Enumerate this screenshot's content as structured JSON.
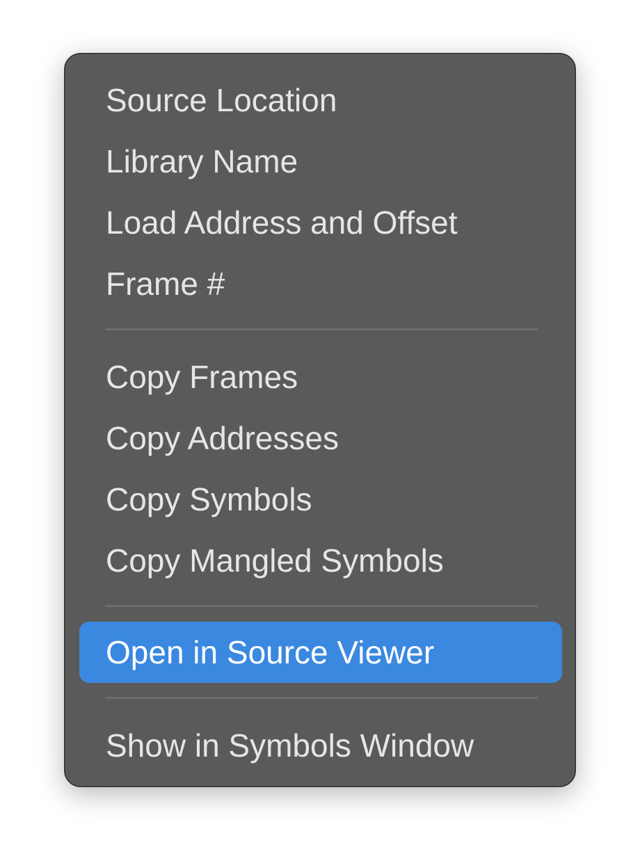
{
  "menu": {
    "items": [
      {
        "label": "Source Location"
      },
      {
        "label": "Library Name"
      },
      {
        "label": "Load Address and Offset"
      },
      {
        "label": "Frame #"
      },
      {
        "label": "Copy Frames"
      },
      {
        "label": "Copy Addresses"
      },
      {
        "label": "Copy Symbols"
      },
      {
        "label": "Copy Mangled Symbols"
      },
      {
        "label": "Open in Source Viewer",
        "state": "highlighted"
      },
      {
        "label": "Show in Symbols Window"
      }
    ]
  },
  "colors": {
    "menu_background": "#5a5a5a",
    "highlight": "#3a88e0",
    "text": "#e6e6e6",
    "separator": "#6c6c6c"
  }
}
